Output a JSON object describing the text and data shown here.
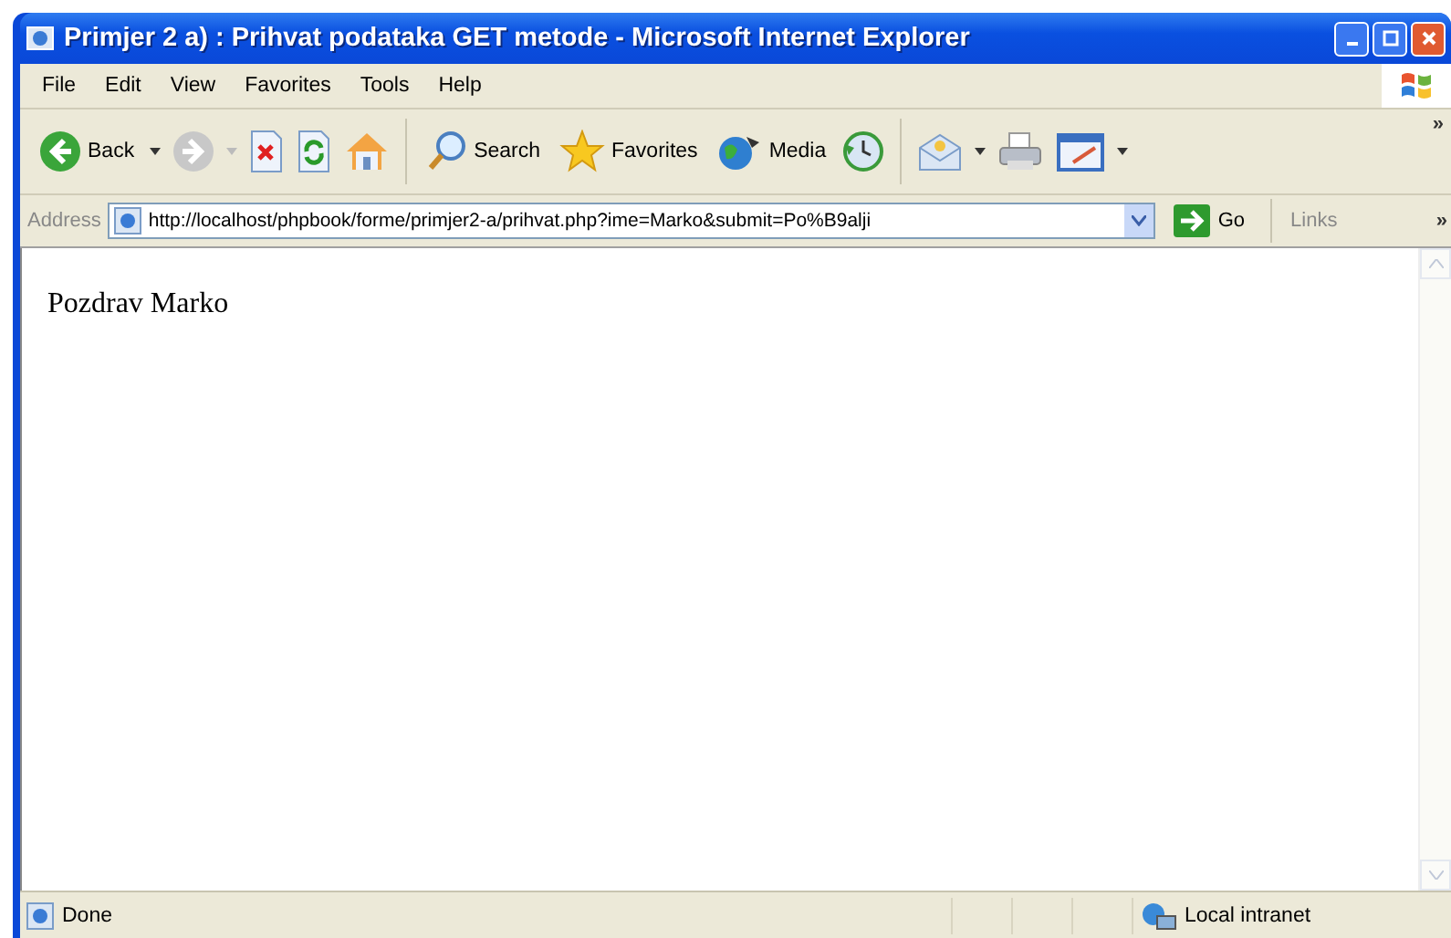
{
  "window": {
    "title": "Primjer 2 a) : Prihvat podataka GET metode - Microsoft Internet Explorer"
  },
  "menu": [
    "File",
    "Edit",
    "View",
    "Favorites",
    "Tools",
    "Help"
  ],
  "toolbar": {
    "back": "Back",
    "search": "Search",
    "favorites": "Favorites",
    "media": "Media",
    "more": "»"
  },
  "address": {
    "label": "Address",
    "value": "http://localhost/phpbook/forme/primjer2-a/prihvat.php?ime=Marko&submit=Po%B9alji",
    "go": "Go",
    "links": "Links",
    "more": "»"
  },
  "content": {
    "text": "Pozdrav Marko"
  },
  "status_bar": {
    "text": "Done",
    "zone": "Local intranet"
  }
}
